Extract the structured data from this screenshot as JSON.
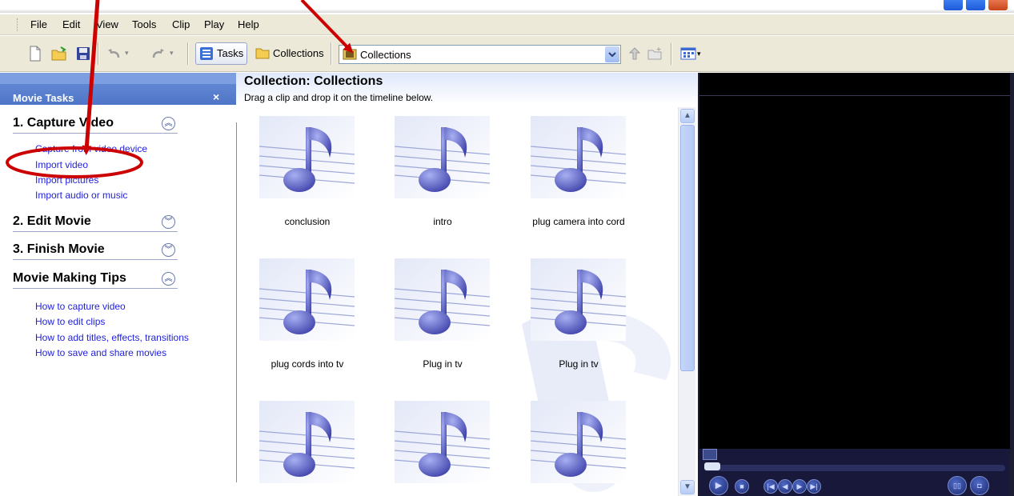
{
  "annotation_caption": "the only visible text across the top is partially cut off by the screenshot edge",
  "menu": [
    "File",
    "Edit",
    "View",
    "Tools",
    "Clip",
    "Play",
    "Help"
  ],
  "toolbar": {
    "tasks_label": "Tasks",
    "collections_label": "Collections",
    "collection_combo_value": "Collections"
  },
  "task_pane": {
    "title": "Movie Tasks",
    "close": "×",
    "sections": [
      {
        "label": "1. Capture Video",
        "expanded": true,
        "links": [
          "Capture from video device",
          "Import video",
          "Import pictures",
          "Import audio or music"
        ]
      },
      {
        "label": "2. Edit Movie",
        "expanded": false,
        "links": []
      },
      {
        "label": "3. Finish Movie",
        "expanded": false,
        "links": []
      },
      {
        "label": "Movie Making Tips",
        "expanded": true,
        "links": [
          "How to capture video",
          "How to edit clips",
          "How to add titles, effects, transitions",
          "How to save and share movies"
        ]
      }
    ]
  },
  "collection": {
    "title": "Collection: Collections",
    "subtitle": "Drag a clip and drop it on the timeline below.",
    "clips": [
      "conclusion",
      "intro",
      "plug camera into cord",
      "plug cords into tv",
      "Plug in tv",
      "Plug in tv",
      "",
      "",
      ""
    ]
  },
  "colors": {
    "taskpane_header": "#5a80cf",
    "link": "#2222dd",
    "annotation": "#cc0000",
    "monitor_bg": "#000000"
  }
}
